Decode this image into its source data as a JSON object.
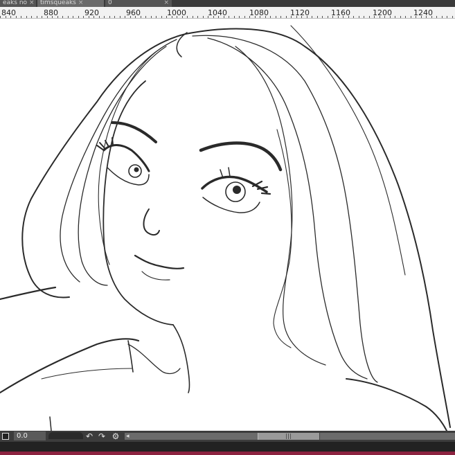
{
  "tabs": [
    {
      "label": "eaks no",
      "close": "×"
    },
    {
      "label": "timsqueaks",
      "close": "×"
    },
    {
      "label": "0",
      "close": "×"
    }
  ],
  "ruler": {
    "labels": [
      "840",
      "880",
      "920",
      "960",
      "1000",
      "1040",
      "1080",
      "1120",
      "1160",
      "1200",
      "1240"
    ]
  },
  "statusbar": {
    "zoom_value": "0.0",
    "icons": [
      "layer-square-icon",
      "undo-icon",
      "redo-icon",
      "rotate-icon",
      "scroll-left-icon"
    ]
  },
  "colors": {
    "chrome_dark": "#3c3c3c",
    "ruler_bg": "#f2f2f2",
    "accent_strip": "#8c2340",
    "line_art": "#2a2a2a"
  }
}
